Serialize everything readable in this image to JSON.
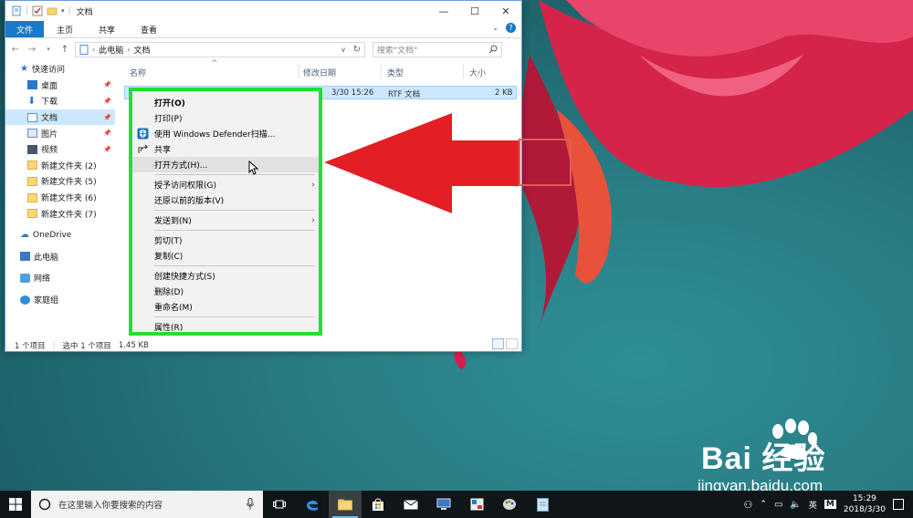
{
  "window": {
    "title": "文档",
    "ribbon_tabs": [
      "文件",
      "主页",
      "共享",
      "查看"
    ]
  },
  "address": {
    "segments": [
      "此电脑",
      "文档"
    ],
    "search_placeholder": "搜索\"文档\""
  },
  "nav": {
    "quick_access": "快速访问",
    "items": [
      {
        "label": "桌面",
        "icon": "desktop-icon",
        "pinned": true
      },
      {
        "label": "下载",
        "icon": "download-icon",
        "pinned": true
      },
      {
        "label": "文档",
        "icon": "documents-icon",
        "pinned": true,
        "selected": true
      },
      {
        "label": "图片",
        "icon": "pictures-icon",
        "pinned": true
      },
      {
        "label": "视频",
        "icon": "videos-icon",
        "pinned": true
      },
      {
        "label": "新建文件夹 (2)",
        "icon": "folder-icon"
      },
      {
        "label": "新建文件夹 (5)",
        "icon": "folder-icon"
      },
      {
        "label": "新建文件夹 (6)",
        "icon": "folder-icon"
      },
      {
        "label": "新建文件夹 (7)",
        "icon": "folder-icon"
      }
    ],
    "onedrive": "OneDrive",
    "this_pc": "此电脑",
    "network": "网络",
    "homegroup": "家庭组"
  },
  "columns": {
    "name": "名称",
    "modified": "修改日期",
    "type": "类型",
    "size": "大小"
  },
  "file": {
    "modified": "3/30 15:26",
    "type": "RTF 文档",
    "size": "2 KB"
  },
  "status": {
    "count": "1 个项目",
    "selected": "选中 1 个项目",
    "size": "1.45 KB"
  },
  "context_menu": {
    "items": [
      {
        "label": "打开(O)",
        "bold": true
      },
      {
        "label": "打印(P)"
      },
      {
        "label": "使用 Windows Defender扫描...",
        "icon": "defender-shield-icon"
      },
      {
        "label": "共享",
        "icon": "share-icon"
      },
      {
        "label": "打开方式(H)...",
        "hover": true
      },
      {
        "sep": true
      },
      {
        "label": "授予访问权限(G)",
        "submenu": true
      },
      {
        "label": "还原以前的版本(V)"
      },
      {
        "sep": true
      },
      {
        "label": "发送到(N)",
        "submenu": true
      },
      {
        "sep": true
      },
      {
        "label": "剪切(T)"
      },
      {
        "label": "复制(C)"
      },
      {
        "sep": true
      },
      {
        "label": "创建快捷方式(S)"
      },
      {
        "label": "删除(D)"
      },
      {
        "label": "重命名(M)"
      },
      {
        "sep": true
      },
      {
        "label": "属性(R)"
      }
    ]
  },
  "watermark": {
    "brand": "Bai 经验",
    "url": "jingyan.baidu.com"
  },
  "taskbar": {
    "search_placeholder": "在这里输入你要搜索的内容",
    "ime": "英",
    "ime_mode": "M",
    "time": "15:29",
    "date": "2018/3/30"
  },
  "colors": {
    "highlight_green": "#22e02f",
    "arrow_red": "#e31e24",
    "selection_blue": "#cce8ff",
    "ribbon_file_blue": "#1979ca"
  }
}
